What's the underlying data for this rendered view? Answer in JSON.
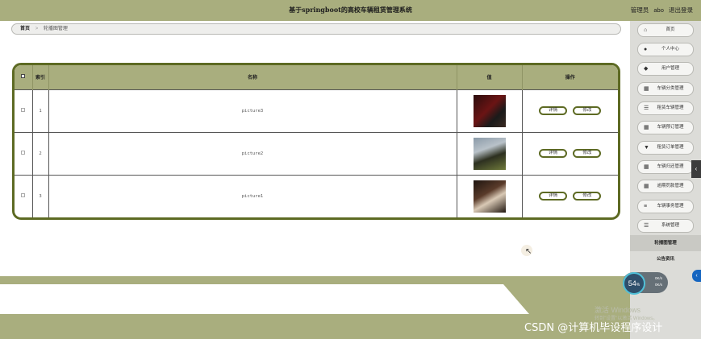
{
  "header": {
    "title": "基于springboot的高校车辆租赁管理系统",
    "role": "管理员",
    "username": "abo",
    "logout": "退出登录"
  },
  "breadcrumb": {
    "home": "首页",
    "separator": ">",
    "current": "轮播图管理"
  },
  "table": {
    "columns": [
      "索引",
      "名称",
      "值",
      "操作"
    ],
    "rows": [
      {
        "index": "1",
        "name": "picture3",
        "image": "dark red car photo",
        "detail_label": "详情",
        "edit_label": "修改"
      },
      {
        "index": "2",
        "name": "picture2",
        "image": "off-road car photo",
        "detail_label": "详情",
        "edit_label": "修改"
      },
      {
        "index": "3",
        "name": "picture1",
        "image": "silver car photo",
        "detail_label": "详情",
        "edit_label": "修改"
      }
    ]
  },
  "sidebar": {
    "items": [
      {
        "label": "首页",
        "icon": "home-icon"
      },
      {
        "label": "个人中心",
        "icon": "user-icon"
      },
      {
        "label": "用户管理",
        "icon": "shield-icon"
      },
      {
        "label": "车辆分类管理",
        "icon": "grid-icon"
      },
      {
        "label": "租赁车辆管理",
        "icon": "list-icon"
      },
      {
        "label": "车辆预订管理",
        "icon": "grid-icon"
      },
      {
        "label": "租赁订单管理",
        "icon": "cup-icon"
      },
      {
        "label": "车辆归还管理",
        "icon": "grid-icon"
      },
      {
        "label": "逾期罚款管理",
        "icon": "grid-icon"
      },
      {
        "label": "车辆事务管理",
        "icon": "sliders-icon"
      },
      {
        "label": "系统管理",
        "icon": "list-icon"
      }
    ],
    "subitems": [
      {
        "label": "轮播图管理",
        "active": true
      },
      {
        "label": "公告资讯",
        "active": false
      }
    ]
  },
  "widget": {
    "percent": "54",
    "unit": "%",
    "up_speed": "0K/s",
    "down_speed": "0K/s"
  },
  "watermarks": {
    "windows_title": "激活 Windows",
    "windows_sub": "转到\"设置\"以激活 Windows。",
    "csdn": "CSDN @计算机毕设程序设计"
  },
  "colors": {
    "accent": "#a9ae7e",
    "border": "#5d6a23"
  }
}
